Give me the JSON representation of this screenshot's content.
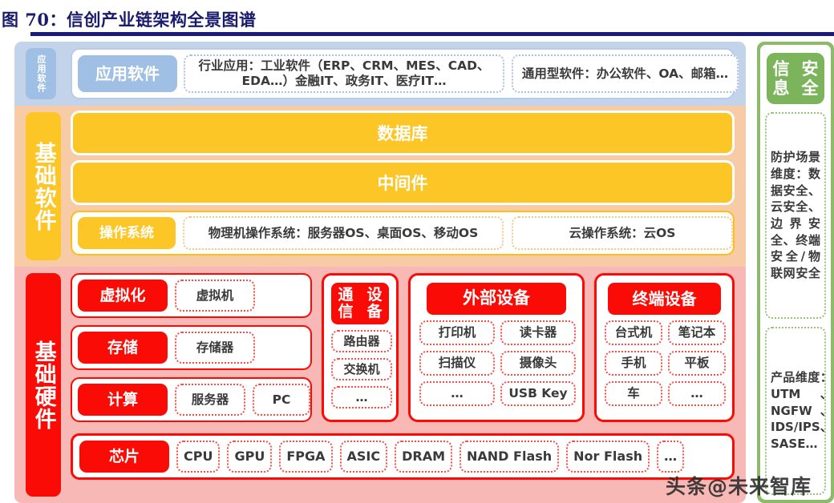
{
  "title": "图 70：信创产业链架构全景图谱",
  "layers": {
    "application": {
      "side_label": "应用软件",
      "pill": "应用软件",
      "boxes": [
        "行业应用：工业软件（ERP、CRM、MES、CAD、EDA…）金融IT、政务IT、医疗IT…",
        "通用型软件：办公软件、OA、邮箱…"
      ]
    },
    "basic_software": {
      "side_label": "基础软件",
      "database_bar": "数据库",
      "middleware_bar": "中间件",
      "os_pill": "操作系统",
      "os_boxes": [
        "物理机操作系统：服务器OS、桌面OS、移动OS",
        "云操作系统：云OS"
      ]
    },
    "basic_hardware": {
      "side_label": "基础硬件",
      "rows": [
        {
          "pill": "虚拟化",
          "items": [
            "虚拟机"
          ]
        },
        {
          "pill": "存储",
          "items": [
            "存储器"
          ]
        },
        {
          "pill": "计算",
          "items": [
            "服务器",
            "PC"
          ]
        }
      ],
      "cards": [
        {
          "head": "通信\n设备",
          "items": [
            "路由器",
            "交换机",
            "…"
          ]
        },
        {
          "head": "外部设备",
          "items": [
            "打印机",
            "读卡器",
            "扫描仪",
            "摄像头",
            "…",
            "USB Key"
          ]
        },
        {
          "head": "终端设备",
          "items": [
            "台式机",
            "笔记本",
            "手机",
            "平板",
            "车",
            "…"
          ]
        }
      ],
      "chip_row": {
        "pill": "芯片",
        "items": [
          "CPU",
          "GPU",
          "FPGA",
          "ASIC",
          "DRAM",
          "NAND Flash",
          "Nor Flash",
          "…"
        ]
      }
    },
    "security": {
      "head": "信息\n安全",
      "boxes": [
        "防护场景维度：数据安全、云安全、边界安全、终端安全/物联网安全",
        "产品维度：UTM、NGFW、IDS/IPS、SASE…"
      ]
    }
  },
  "watermark": "头条@未来智库",
  "colors": {
    "title": "#1b1b6e",
    "app_band": "#c3d3ea",
    "software_band": "#f6cba6",
    "hardware_band": "#f8b8b5",
    "amber": "#fcc627",
    "red": "#fb0b06",
    "green": "#8cb96a",
    "app_blue": "#9fc0e4"
  }
}
